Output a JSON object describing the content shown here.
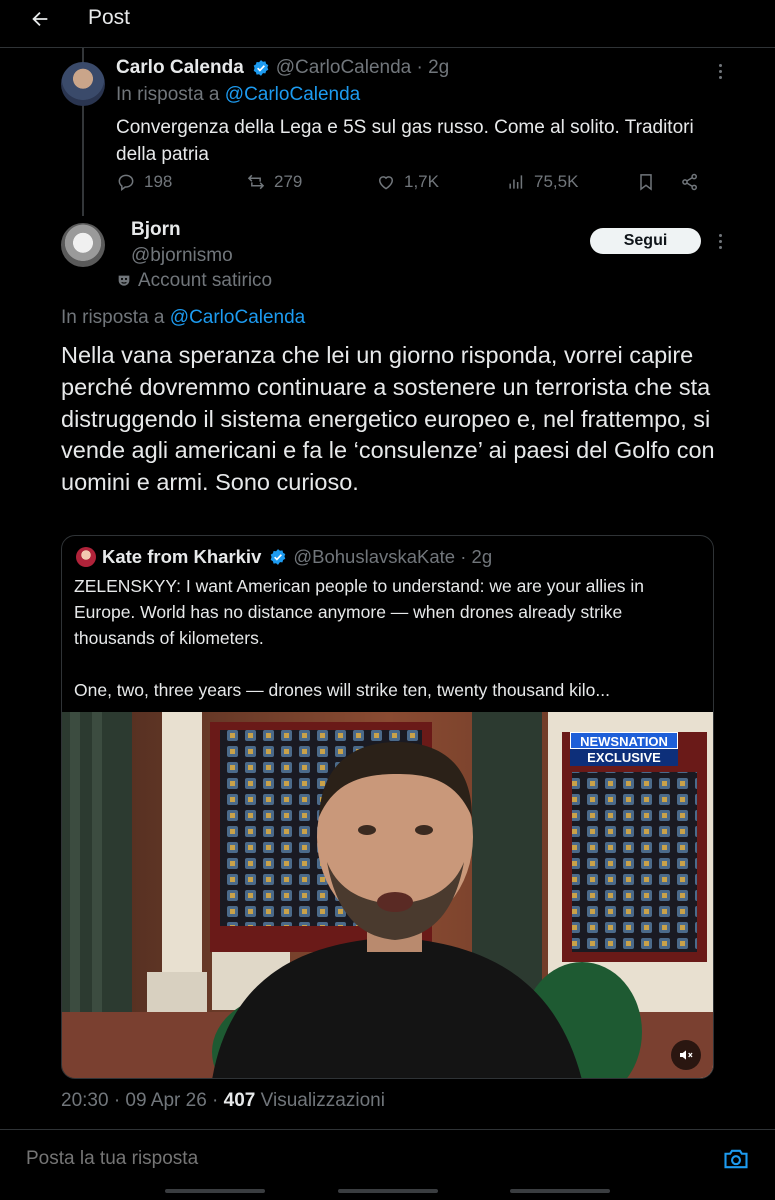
{
  "header": {
    "title": "Post"
  },
  "parent_post": {
    "author_name": "Carlo Calenda",
    "handle_time": "@CarloCalenda · 2g",
    "reply_prefix": "In risposta a",
    "reply_to": "@CarloCalenda",
    "text": "Convergenza della Lega e 5S sul gas russo. Come al solito. Traditori della patria",
    "replies": "198",
    "reposts": "279",
    "likes": "1,7K",
    "views": "75,5K"
  },
  "main_post": {
    "author_name": "Bjorn",
    "handle": "@bjornismo",
    "account_label": "Account satirico",
    "follow_label": "Segui",
    "reply_prefix": "In risposta a",
    "reply_to": "@CarloCalenda",
    "text": "Nella vana speranza che lei un giorno risponda, vorrei capire perché dovremmo continuare a sostenere un terrorista che sta distruggendo il sistema energetico europeo e, nel frattempo, si vende agli americani e fa le ‘consulenze’ ai paesi del Golfo con uomini e armi. Sono curioso.",
    "time": "20:30 · 09 Apr 26 ·",
    "views_count": "407",
    "views_label": "Visualizzazioni"
  },
  "quoted_post": {
    "author_name": "Kate from Kharkiv",
    "handle_time": "@BohuslavskaKate · 2g",
    "text_1": "ZELENSKYY: I want American people to understand: we are your allies in Europe. World has no distance anymore — when drones already strike thousands of kilometers.",
    "text_2": "One, two, three years — drones will strike ten, twenty thousand kilo...",
    "video_badge_top": "NEWSNATION",
    "video_badge_bottom": "EXCLUSIVE"
  },
  "compose": {
    "placeholder": "Posta la tua risposta"
  },
  "colors": {
    "accent": "#1d9bf0",
    "background": "#000000",
    "text": "#e7e9ea",
    "muted": "#71767b"
  }
}
